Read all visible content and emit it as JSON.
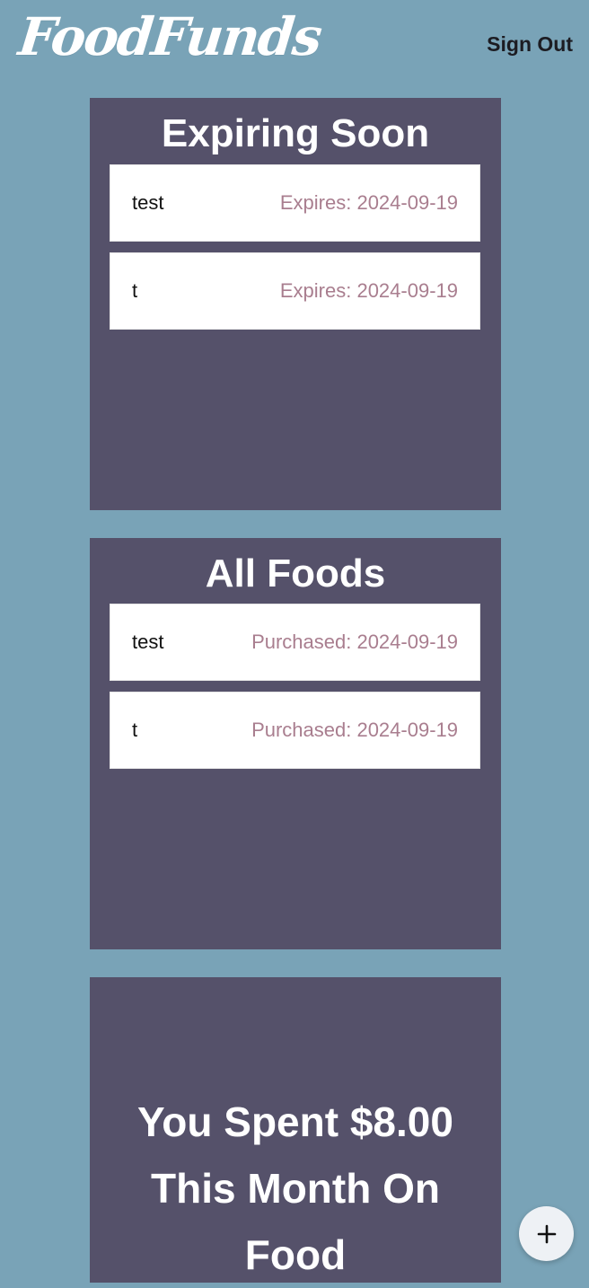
{
  "header": {
    "logo_text": "FoodFunds",
    "sign_out_label": "Sign Out"
  },
  "expiring_soon": {
    "title": "Expiring Soon",
    "items": [
      {
        "name": "test",
        "meta": "Expires: 2024-09-19"
      },
      {
        "name": "t",
        "meta": "Expires: 2024-09-19"
      }
    ]
  },
  "all_foods": {
    "title": "All Foods",
    "items": [
      {
        "name": "test",
        "meta": "Purchased: 2024-09-19"
      },
      {
        "name": "t",
        "meta": "Purchased: 2024-09-19"
      }
    ]
  },
  "spending": {
    "summary_text": "You Spent $8.00 This Month On Food"
  },
  "fab": {
    "icon": "plus-icon"
  },
  "colors": {
    "background": "#79a3b7",
    "panel": "#55516a",
    "card": "#ffffff",
    "meta_text": "#a97e8f",
    "header_text": "#1c1c22"
  }
}
